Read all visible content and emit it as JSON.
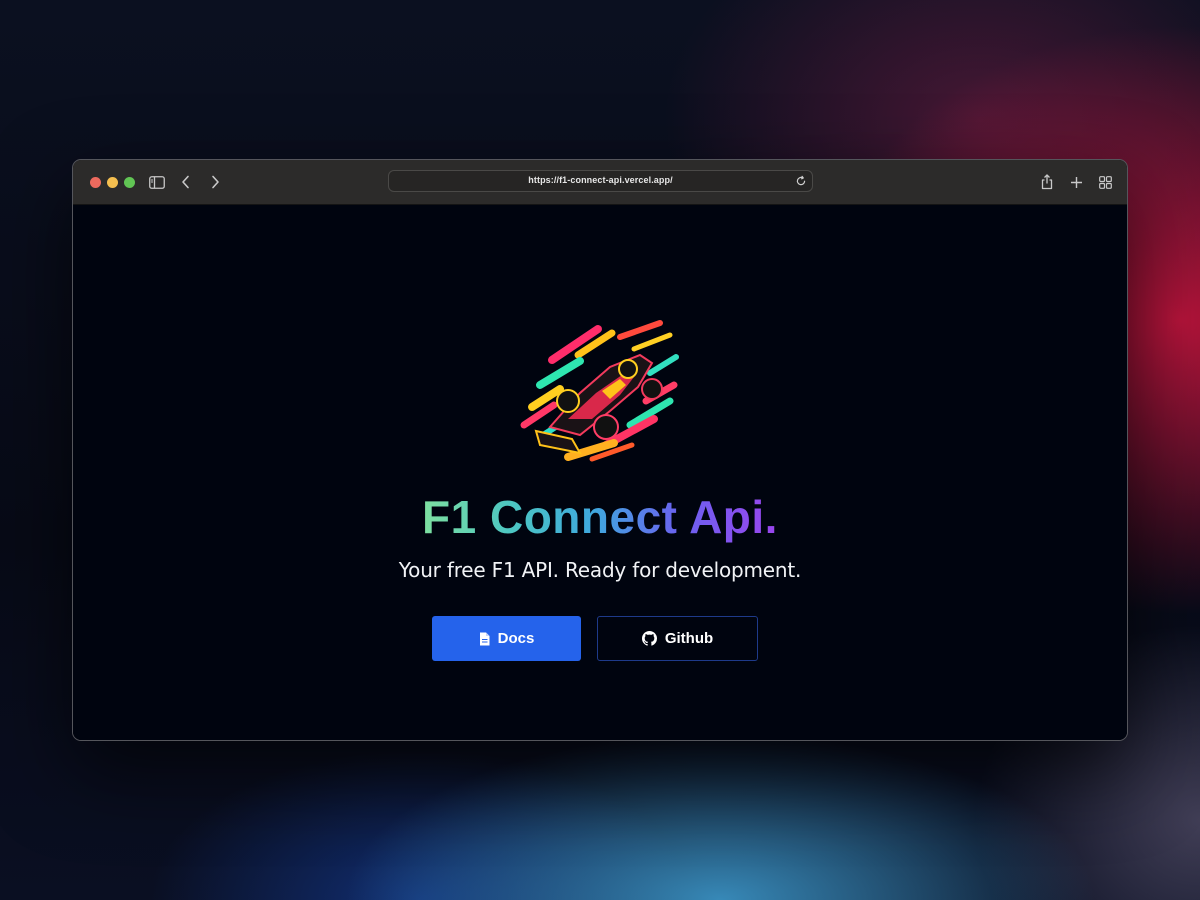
{
  "browser": {
    "url": "https://f1-connect-api.vercel.app/",
    "icons": {
      "sidebar": "sidebar-icon",
      "back": "chevron-left-icon",
      "forward": "chevron-right-icon",
      "reload": "reload-icon",
      "share": "share-icon",
      "new_tab": "plus-icon",
      "tab_overview": "grid-icon"
    }
  },
  "hero": {
    "logo": "f1-car-logo",
    "title": "F1 Connect Api.",
    "subtitle": "Your free F1 API. Ready for development.",
    "buttons": {
      "docs_label": "Docs",
      "docs_icon": "document-icon",
      "github_label": "Github",
      "github_icon": "github-icon"
    }
  },
  "colors": {
    "accent": "#2563eb",
    "page_background": "#00040f",
    "title_gradient": [
      "#7ee0a0",
      "#3fa8de",
      "#9a45ee"
    ]
  }
}
